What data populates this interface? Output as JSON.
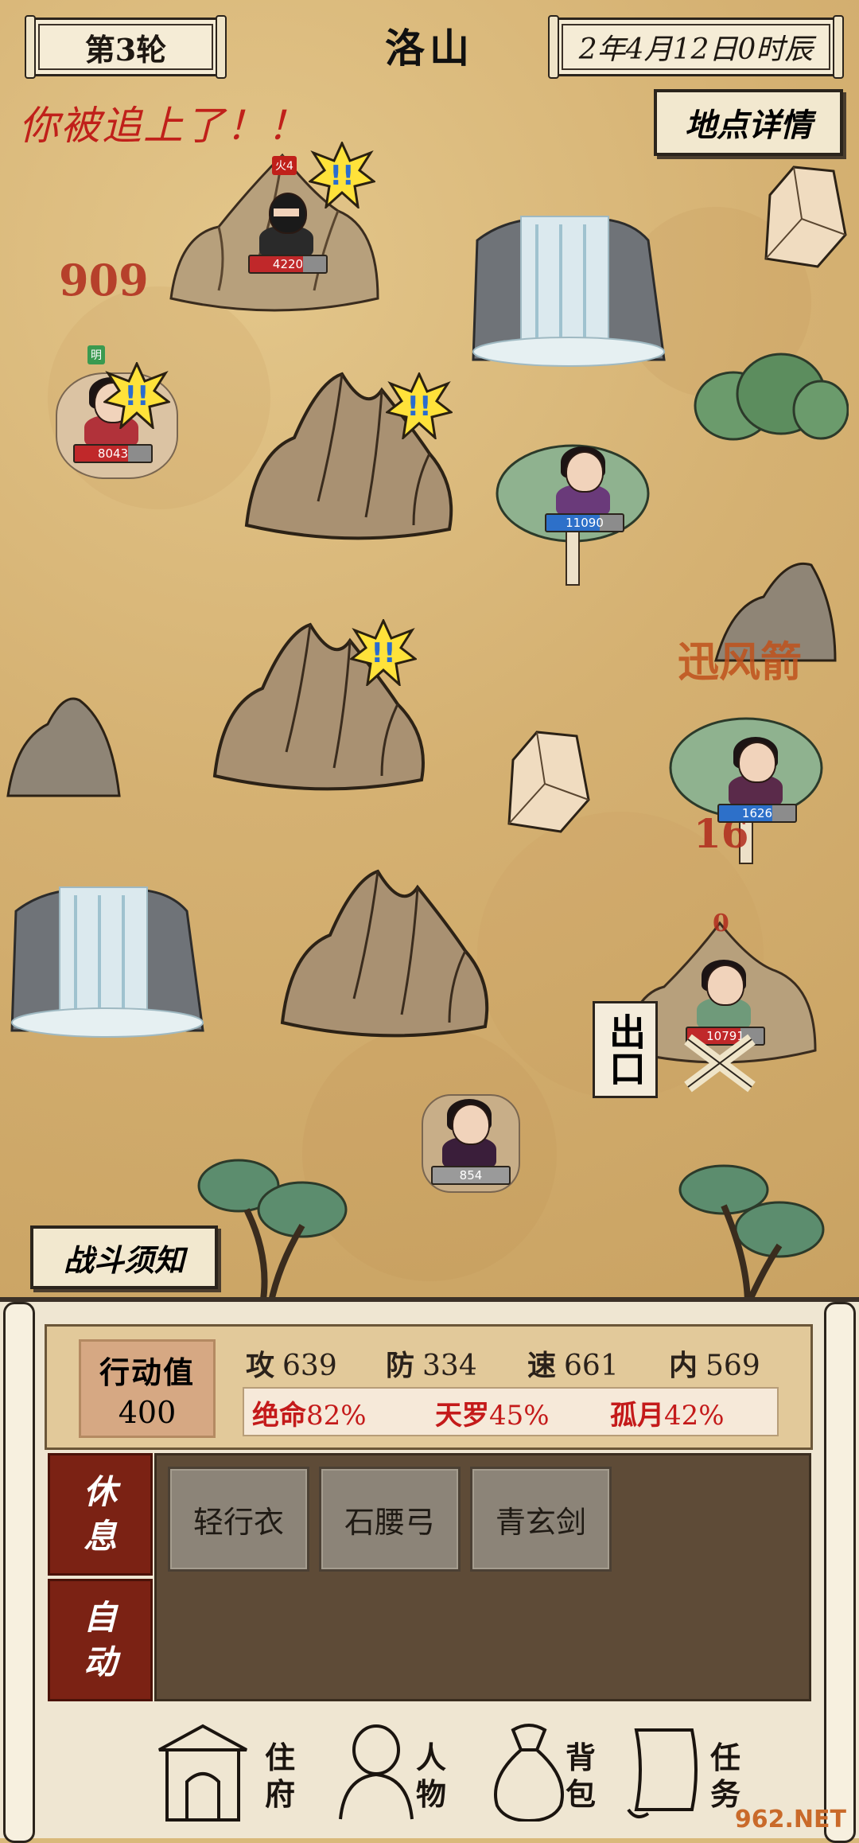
{
  "header": {
    "round": "第3轮",
    "location": "洛山",
    "date": "2年4月12日0时辰",
    "alert": "你被追上了！！",
    "location_detail_button": "地点详情"
  },
  "map": {
    "floating_numbers": [
      "909",
      "迅风箭",
      "16",
      "0"
    ],
    "characters": [
      {
        "tag": "火4",
        "hp": "4220"
      },
      {
        "tag": "明",
        "hp": "8043"
      },
      {
        "hp": "11090"
      },
      {
        "hp": "1626"
      },
      {
        "hp": "10791"
      },
      {
        "hp": "854"
      }
    ],
    "exit_label": "出口",
    "alert_mark": "!!"
  },
  "battle_notice_button": "战斗须知",
  "stats": {
    "action_label": "行动值",
    "action_value": "400",
    "attack": {
      "label": "攻",
      "value": "639"
    },
    "defense": {
      "label": "防",
      "value": "334"
    },
    "speed": {
      "label": "速",
      "value": "661"
    },
    "inner": {
      "label": "内",
      "value": "569"
    },
    "skills": [
      {
        "name": "绝命",
        "value": "82%"
      },
      {
        "name": "天罗",
        "value": "45%"
      },
      {
        "name": "孤月",
        "value": "42%"
      }
    ]
  },
  "side_buttons": {
    "rest": [
      "休",
      "息"
    ],
    "auto": [
      "自",
      "动"
    ]
  },
  "inventory": [
    "轻行衣",
    "石腰弓",
    "青玄剑"
  ],
  "nav": [
    {
      "label": [
        "住",
        "府"
      ],
      "icon": "gate-icon"
    },
    {
      "label": [
        "人",
        "物"
      ],
      "icon": "character-icon"
    },
    {
      "label": [
        "背",
        "包"
      ],
      "icon": "bag-icon"
    },
    {
      "label": [
        "任",
        "务"
      ],
      "icon": "scroll-icon"
    }
  ],
  "watermark": "962.NET"
}
